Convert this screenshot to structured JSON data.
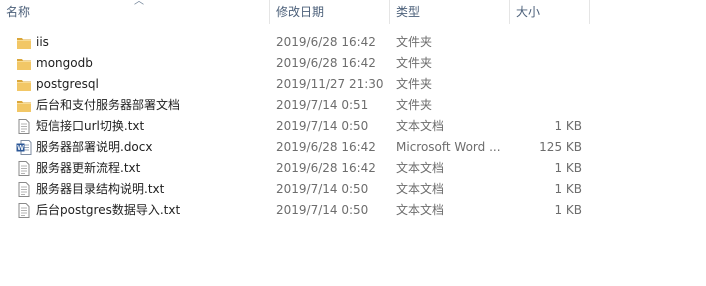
{
  "columns": {
    "name": "名称",
    "date": "修改日期",
    "type": "类型",
    "size": "大小"
  },
  "files": [
    {
      "icon": "folder-icon",
      "name": "iis",
      "date": "2019/6/28 16:42",
      "type": "文件夹",
      "size": ""
    },
    {
      "icon": "folder-icon",
      "name": "mongodb",
      "date": "2019/6/28 16:42",
      "type": "文件夹",
      "size": ""
    },
    {
      "icon": "folder-icon",
      "name": "postgresql",
      "date": "2019/11/27 21:30",
      "type": "文件夹",
      "size": ""
    },
    {
      "icon": "folder-icon",
      "name": "后台和支付服务器部署文档",
      "date": "2019/7/14 0:51",
      "type": "文件夹",
      "size": ""
    },
    {
      "icon": "text-file-icon",
      "name": "短信接口url切换.txt",
      "date": "2019/7/14 0:50",
      "type": "文本文档",
      "size": "1 KB"
    },
    {
      "icon": "word-doc-icon",
      "name": "服务器部署说明.docx",
      "date": "2019/6/28 16:42",
      "type": "Microsoft Word ...",
      "size": "125 KB"
    },
    {
      "icon": "text-file-icon",
      "name": "服务器更新流程.txt",
      "date": "2019/6/28 16:42",
      "type": "文本文档",
      "size": "1 KB"
    },
    {
      "icon": "text-file-icon",
      "name": "服务器目录结构说明.txt",
      "date": "2019/7/14 0:50",
      "type": "文本文档",
      "size": "1 KB"
    },
    {
      "icon": "text-file-icon",
      "name": "后台postgres数据导入.txt",
      "date": "2019/7/14 0:50",
      "type": "文本文档",
      "size": "1 KB"
    }
  ],
  "colors": {
    "header_text": "#4c607a",
    "secondary_text": "#6d6d6d",
    "folder_fill": "#e8b64a",
    "word_blue": "#2b5797"
  }
}
